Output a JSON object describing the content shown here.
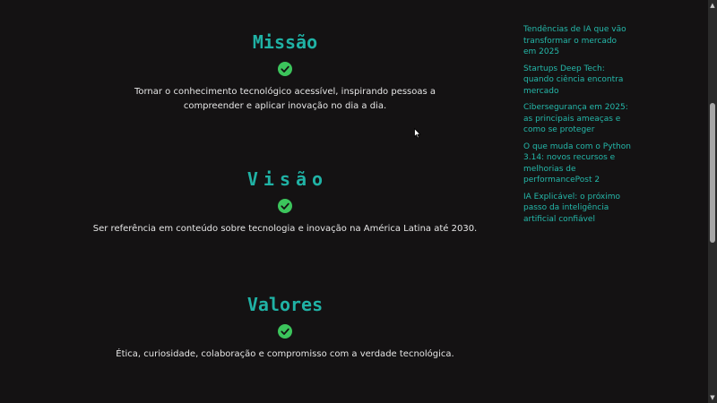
{
  "sections": [
    {
      "title": "Missão",
      "text": "Tornar o conhecimento tecnológico acessível, inspirando pessoas a compreender e aplicar inovação no dia a dia."
    },
    {
      "title": "Visão",
      "text": "Ser referência em conteúdo sobre tecnologia e inovação na América Latina até 2030."
    },
    {
      "title": "Valores",
      "text": "Ética, curiosidade, colaboração e compromisso com a verdade tecnológica."
    }
  ],
  "sidebar": {
    "links": [
      "Tendências de IA que vão transformar o mercado em 2025",
      "Startups Deep Tech: quando ciência encontra mercado",
      "Cibersegurança em 2025: as principais ameaças e como se proteger",
      "O que muda com o Python 3.14: novos recursos e melhorias de performancePost 2",
      "IA Explicável: o próximo passo da inteligência artificial confiável"
    ]
  },
  "colors": {
    "background": "#141213",
    "title": "#20b2a5",
    "check": "#3cc45c",
    "link": "#24b8aa"
  },
  "icons": {
    "check": "check-circle-icon",
    "scroll_up": "arrow-up-icon",
    "scroll_down": "arrow-down-icon",
    "cursor": "mouse-pointer-icon"
  }
}
